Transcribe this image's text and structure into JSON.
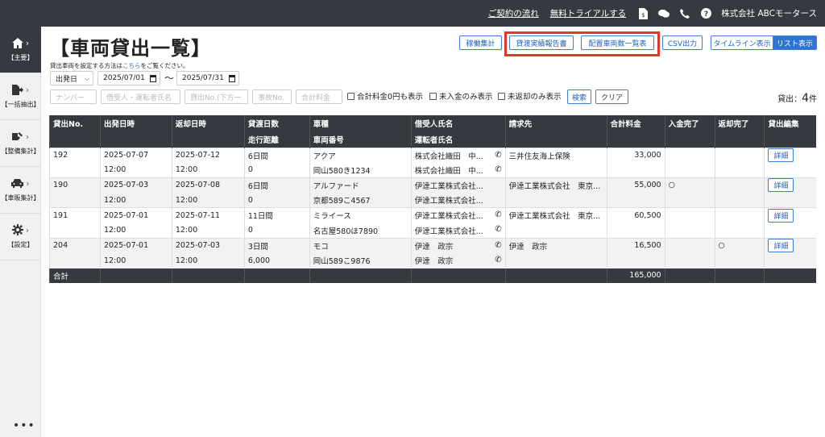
{
  "header": {
    "links": [
      "ご契約の流れ",
      "無料トライアルする"
    ],
    "company": "株式会社 ABCモータース",
    "icons": [
      "invoice-icon",
      "chat-icon",
      "phone-icon",
      "help-icon"
    ]
  },
  "sidebar": {
    "items": [
      {
        "label": "【主要】",
        "icon": "home-icon"
      },
      {
        "label": "【一括抽出】",
        "icon": "file-export-icon"
      },
      {
        "label": "【整備集計】",
        "icon": "maintenance-icon"
      },
      {
        "label": "【車販集計】",
        "icon": "car-sales-icon"
      },
      {
        "label": "【設定】",
        "icon": "gear-icon"
      }
    ],
    "more": "•••"
  },
  "page": {
    "title": "【車両貸出一覧】",
    "help_prefix": "貸出車両を設定する方法は",
    "help_link": "こちら",
    "help_suffix": "をご覧ください。"
  },
  "toolbar": {
    "operation_summary": "稼働集計",
    "lending_report": "貸渡実績報告書",
    "vehicle_list": "配置車両数一覧表",
    "csv": "CSV出力",
    "timeline": "タイムライン表示",
    "list": "リスト表示"
  },
  "filters": {
    "date_type": "出発日",
    "date_from": "2025/07/01",
    "tilde": "〜",
    "date_to": "2025/07/31",
    "number_ph": "ナンバー",
    "borrower_ph": "借受人・運転者氏名",
    "lending_no_ph": "貸出No.(下方一",
    "accident_ph": "事故No.",
    "total_fee_ph": "合計料金",
    "chk_zero": "合計料金0円も表示",
    "chk_unpaid": "未入金のみ表示",
    "chk_unreturned": "未返却のみ表示",
    "search": "検索",
    "clear": "クリア"
  },
  "count": {
    "prefix": "貸出：",
    "value": "4",
    "suffix": "件"
  },
  "table": {
    "headers1": [
      "貸出No.",
      "出発日時",
      "返却日時",
      "貸渡日数",
      "車種",
      "借受人氏名",
      "請求先",
      "合計料金",
      "入金完了",
      "返却完了",
      "貸出編集"
    ],
    "headers2": [
      "",
      "",
      "",
      "走行距離",
      "車両番号",
      "運転者氏名",
      "",
      "",
      "",
      "",
      ""
    ],
    "rows": [
      {
        "no": "192",
        "dep_date": "2025-07-07",
        "dep_time": "12:00",
        "ret_date": "2025-07-12",
        "ret_time": "12:00",
        "days": "6日間",
        "distance": "0",
        "model": "アクア",
        "plate": "岡山580き1234",
        "borrower": "株式会社織田　中...",
        "driver": "株式会社織田　中...",
        "borrower_tel": true,
        "driver_tel": true,
        "billing": "三井住友海上保険",
        "total": "33,000",
        "paid": "",
        "returned": "",
        "detail": "詳細"
      },
      {
        "no": "190",
        "dep_date": "2025-07-03",
        "dep_time": "12:00",
        "ret_date": "2025-07-08",
        "ret_time": "12:00",
        "days": "6日間",
        "distance": "0",
        "model": "アルファード",
        "plate": "京都589こ4567",
        "borrower": "伊達工業株式会社...",
        "driver": "伊達工業株式会社...",
        "borrower_tel": false,
        "driver_tel": false,
        "billing": "伊達工業株式会社　東京...",
        "total": "55,000",
        "paid": "○",
        "returned": "",
        "detail": "詳細"
      },
      {
        "no": "191",
        "dep_date": "2025-07-01",
        "dep_time": "12:00",
        "ret_date": "2025-07-11",
        "ret_time": "12:00",
        "days": "11日間",
        "distance": "0",
        "model": "ミライース",
        "plate": "名古屋580ほ7890",
        "borrower": "伊達工業株式会社...",
        "driver": "伊達工業株式会社...",
        "borrower_tel": true,
        "driver_tel": true,
        "billing": "伊達工業株式会社　東京...",
        "total": "60,500",
        "paid": "",
        "returned": "",
        "detail": "詳細"
      },
      {
        "no": "204",
        "dep_date": "2025-07-01",
        "dep_time": "12:00",
        "ret_date": "2025-07-03",
        "ret_time": "12:00",
        "days": "3日間",
        "distance": "6,000",
        "model": "モコ",
        "plate": "岡山589こ9876",
        "borrower": "伊達　政宗",
        "driver": "伊達　政宗",
        "borrower_tel": true,
        "driver_tel": true,
        "billing": "伊達　政宗",
        "total": "16,500",
        "paid": "",
        "returned": "○",
        "detail": "詳細"
      }
    ],
    "total_label": "合計",
    "total_value": "165,000"
  }
}
